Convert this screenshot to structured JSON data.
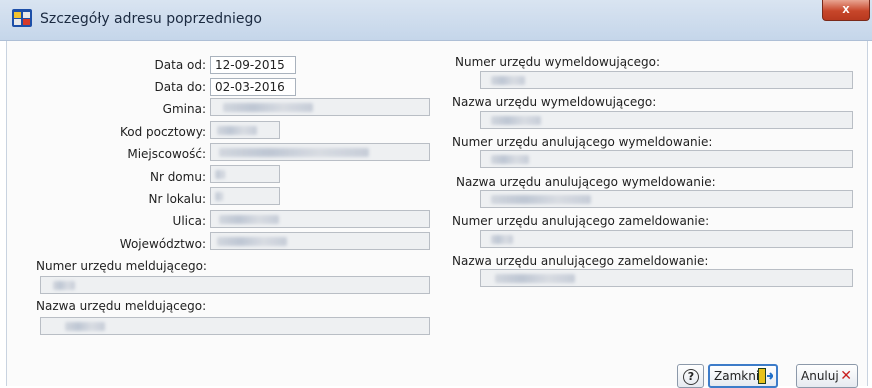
{
  "window": {
    "title": "Szczegóły adresu poprzedniego",
    "close_glyph": "x"
  },
  "left": {
    "data_od_label": "Data od:",
    "data_od_value": "12-09-2015",
    "data_do_label": "Data do:",
    "data_do_value": "02-03-2016",
    "gmina_label": "Gmina:",
    "kod_label": "Kod pocztowy:",
    "miejscowosc_label": "Miejscowość:",
    "nr_domu_label": "Nr domu:",
    "nr_lokalu_label": "Nr lokalu:",
    "ulica_label": "Ulica:",
    "wojewodztwo_label": "Województwo:",
    "numer_meld_label": "Numer urzędu meldującego:",
    "nazwa_meld_label": "Nazwa urzędu meldującego:"
  },
  "right": {
    "numer_wymeld_label": "Numer urzędu wymeldowującego:",
    "nazwa_wymeld_label": "Nazwa urzędu wymeldowującego:",
    "numer_anul_wymeld_label": "Numer urzędu anulującego wymeldowanie:",
    "nazwa_anul_wymeld_label": "Nazwa urzędu anulującego wymeldowanie:",
    "numer_anul_zameld_label": "Numer urzędu anulującego zameldowanie:",
    "nazwa_anul_zameld_label": "Nazwa urzędu anulującego zameldowanie:"
  },
  "buttons": {
    "help_glyph": "?",
    "zamknij_label": "Zamknij",
    "anuluj_label": "Anuluj",
    "anuluj_glyph": "✕"
  },
  "icons": {
    "app": "window-app-icon",
    "help": "help-icon",
    "exit": "exit-door-icon",
    "cancel": "cancel-x-icon"
  }
}
